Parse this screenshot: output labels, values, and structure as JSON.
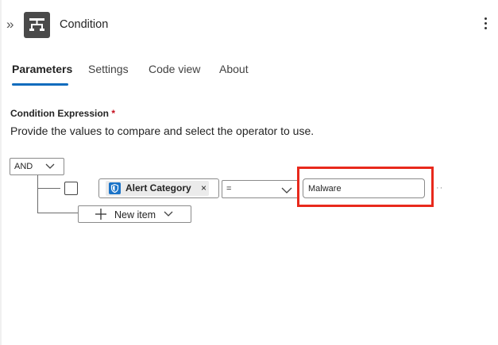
{
  "header": {
    "title": "Condition"
  },
  "tabs": [
    {
      "label": "Parameters"
    },
    {
      "label": "Settings"
    },
    {
      "label": "Code view"
    },
    {
      "label": "About"
    }
  ],
  "condition": {
    "label": "Condition Expression",
    "required_marker": "*",
    "description": "Provide the values to compare and select the operator to use.",
    "group_operator": "AND",
    "rows": [
      {
        "left_token": {
          "label": "Alert Category",
          "remove": "×",
          "icon": "defender-shield-icon"
        },
        "operator": "=",
        "value": "Malware"
      }
    ],
    "new_item_label": "New item"
  },
  "colors": {
    "accent": "#0f6cbd",
    "highlight": "#e8291c",
    "app_icon_bg": "#4a4a4a",
    "token_icon": "#1a73c8"
  }
}
